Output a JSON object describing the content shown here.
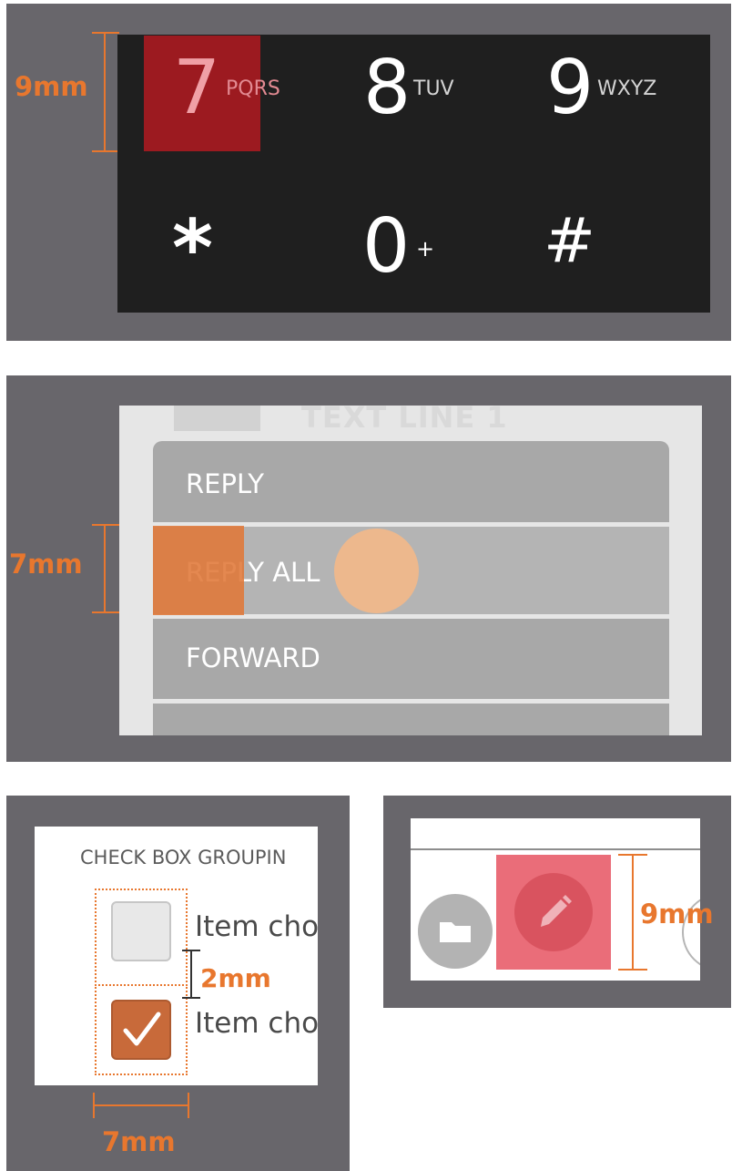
{
  "accent_color": "#e8772e",
  "dialpad": {
    "dimension": "9mm",
    "keys": [
      {
        "digit": "7",
        "letters": "PQRS"
      },
      {
        "digit": "8",
        "letters": "TUV"
      },
      {
        "digit": "9",
        "letters": "WXYZ"
      },
      {
        "digit": "*",
        "letters": ""
      },
      {
        "digit": "0",
        "letters": "+"
      },
      {
        "digit": "#",
        "letters": ""
      }
    ]
  },
  "menu": {
    "dimension": "7mm",
    "background_text": "TEXT LINE 1",
    "items": [
      "REPLY",
      "REPLY ALL",
      "FORWARD"
    ]
  },
  "checkboxes": {
    "title": "CHECK BOX GROUPIN",
    "items": [
      {
        "label": "Item cho",
        "checked": false
      },
      {
        "label": "Item cho",
        "checked": true
      }
    ],
    "spacing": "2mm",
    "width": "7mm"
  },
  "icons": {
    "dimension": "9mm",
    "items": [
      "folder-icon",
      "pencil-icon"
    ]
  }
}
